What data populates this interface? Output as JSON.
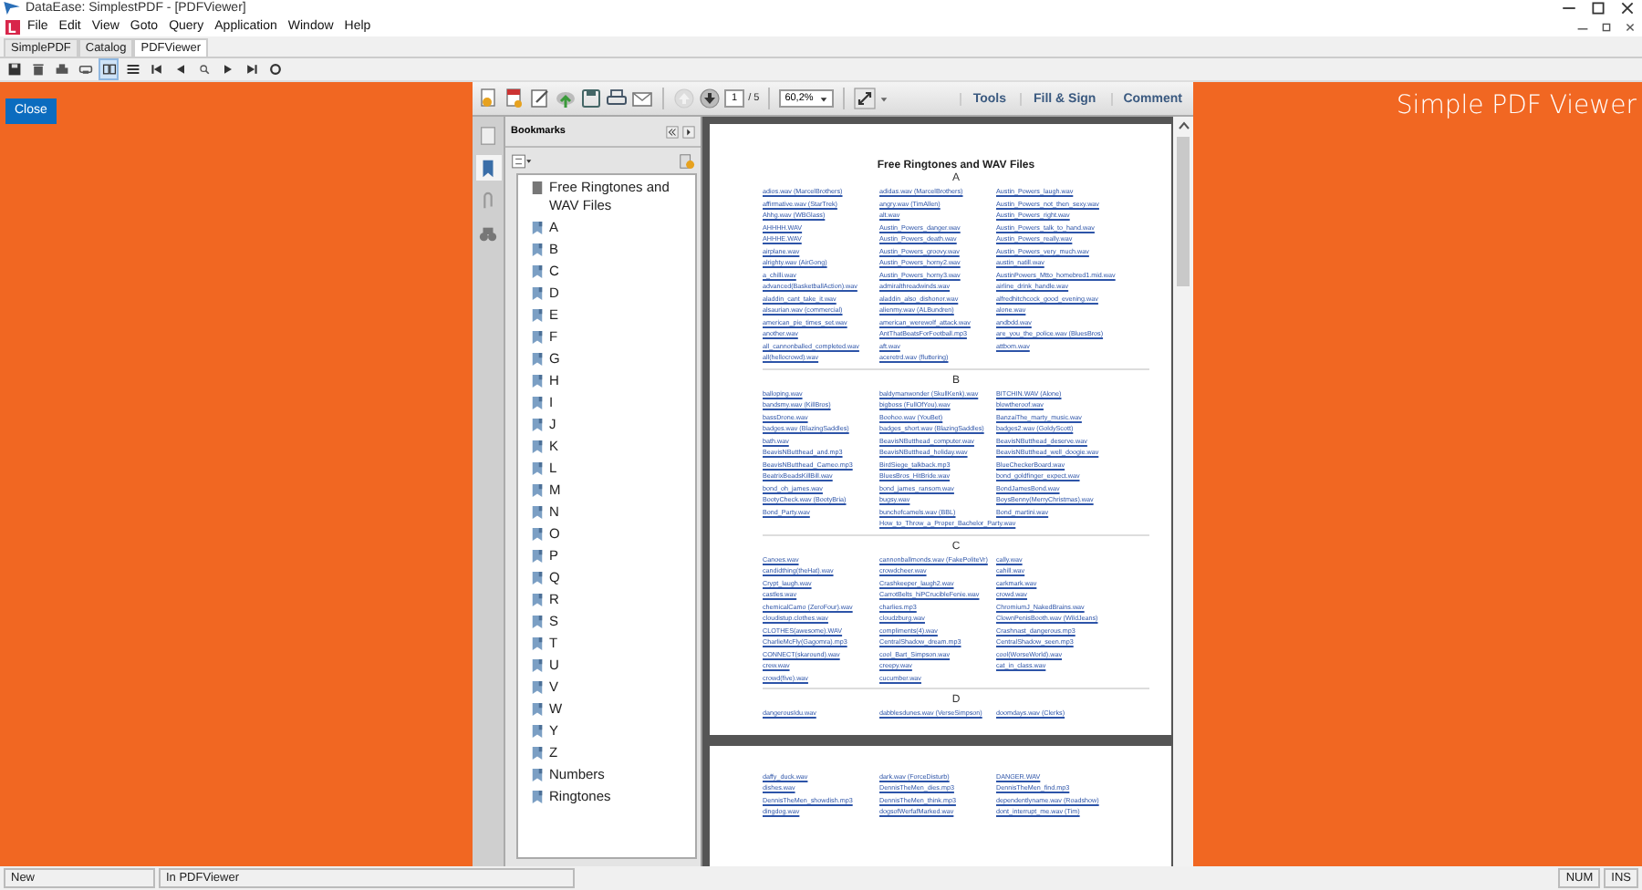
{
  "app": {
    "title": "DataEase: SimplestPDF - [PDFViewer]",
    "menu": [
      "File",
      "Edit",
      "View",
      "Goto",
      "Query",
      "Application",
      "Window",
      "Help"
    ],
    "tabs": [
      {
        "label": "SimplePDF",
        "selected": false
      },
      {
        "label": "Catalog",
        "selected": false
      },
      {
        "label": "PDFViewer",
        "selected": true
      }
    ],
    "toolbar": [
      {
        "kind": "save",
        "selected": false
      },
      {
        "kind": "trash",
        "selected": false
      },
      {
        "kind": "print",
        "selected": false
      },
      {
        "kind": "printer",
        "selected": false
      },
      {
        "kind": "pages",
        "selected": true
      },
      {
        "kind": "list",
        "selected": false
      },
      {
        "kind": "first",
        "selected": false
      },
      {
        "kind": "prev",
        "selected": false
      },
      {
        "kind": "search",
        "selected": false
      },
      {
        "kind": "next",
        "selected": false
      },
      {
        "kind": "last",
        "selected": false
      },
      {
        "kind": "refresh",
        "selected": false
      }
    ],
    "close_button": "Close",
    "viewer_title": "Simple PDF Viewer"
  },
  "pdf": {
    "tools": [
      {
        "kind": "convert"
      },
      {
        "kind": "attach"
      },
      {
        "kind": "edit"
      },
      {
        "kind": "upload"
      },
      {
        "kind": "save"
      },
      {
        "kind": "print"
      },
      {
        "kind": "mail"
      }
    ],
    "nav": [
      {
        "kind": "up",
        "disabled": true
      },
      {
        "kind": "down",
        "disabled": false
      }
    ],
    "page": "1",
    "page_count": "/ 5",
    "zoom": "60,2%",
    "tool_tabs": [
      "Tools",
      "Fill & Sign",
      "Comment"
    ],
    "side_icons": [
      {
        "kind": "page",
        "selected": false
      },
      {
        "kind": "bookmark",
        "selected": true
      },
      {
        "kind": "clip",
        "selected": false
      },
      {
        "kind": "binoculars",
        "selected": false
      }
    ],
    "panel_title": "Bookmarks",
    "bookmarks": [
      {
        "label": "Free Ringtones and WAV Files",
        "kind": "page"
      },
      {
        "label": "A",
        "kind": "mark"
      },
      {
        "label": "B",
        "kind": "mark"
      },
      {
        "label": "C",
        "kind": "mark"
      },
      {
        "label": "D",
        "kind": "mark"
      },
      {
        "label": "E",
        "kind": "mark"
      },
      {
        "label": "F",
        "kind": "mark"
      },
      {
        "label": "G",
        "kind": "mark"
      },
      {
        "label": "H",
        "kind": "mark"
      },
      {
        "label": "I",
        "kind": "mark"
      },
      {
        "label": "J",
        "kind": "mark"
      },
      {
        "label": "K",
        "kind": "mark"
      },
      {
        "label": "L",
        "kind": "mark"
      },
      {
        "label": "M",
        "kind": "mark"
      },
      {
        "label": "N",
        "kind": "mark"
      },
      {
        "label": "O",
        "kind": "mark"
      },
      {
        "label": "P",
        "kind": "mark"
      },
      {
        "label": "Q",
        "kind": "mark"
      },
      {
        "label": "R",
        "kind": "mark"
      },
      {
        "label": "S",
        "kind": "mark"
      },
      {
        "label": "T",
        "kind": "mark"
      },
      {
        "label": "U",
        "kind": "mark"
      },
      {
        "label": "V",
        "kind": "mark"
      },
      {
        "label": "W",
        "kind": "mark"
      },
      {
        "label": "Y",
        "kind": "mark"
      },
      {
        "label": "Z",
        "kind": "mark"
      },
      {
        "label": "Numbers",
        "kind": "mark"
      },
      {
        "label": "Ringtones",
        "kind": "mark"
      }
    ],
    "document": {
      "title": "Free Ringtones and WAV Files",
      "sections": [
        {
          "heading": "A",
          "columns": [
            [
              "adios.wav (MarcelBrothers)",
              "affirmative.wav (StarTrek)",
              "Ahhg.wav (WBGlass)",
              "AHHHH.WAV",
              "AHHHE.WAV",
              "airplane.wav",
              "alrighty.wav (AirGong)",
              "a_chilli.wav",
              "advanced(BasketballAction).wav",
              "aladdin_cant_take_it.wav",
              "alsaurian.wav (commercial)",
              "american_pie_times_set.wav",
              "another.wav",
              "all_cannonballed_completed.wav",
              "all(hellocrowd).wav"
            ],
            [
              "adidas.wav (MarcelBrothers)",
              "angry.wav (TimAllen)",
              "alt.wav",
              "Austin_Powers_danger.wav",
              "Austin_Powers_death.wav",
              "Austin_Powers_groovy.wav",
              "Austin_Powers_horny2.wav",
              "Austin_Powers_horny3.wav",
              "admiralthreadwinds.wav",
              "aladdin_also_dishonor.wav",
              "alienmy.wav (ALBundren)",
              "american_werewolf_attack.wav",
              "AntThatBeatsForFootball.mp3",
              "aft.wav",
              "aceretrd.wav (fluttering)"
            ],
            [
              "Austin_Powers_laugh.wav",
              "Austin_Powers_not_then_sexy.wav",
              "Austin_Powers_right.wav",
              "Austin_Powers_talk_to_hand.wav",
              "Austin_Powers_really.wav",
              "Austin_Powers_very_much.wav",
              "austin_natill.wav",
              "AustinPowers_Mtto_homebred1.mid.wav",
              "airline_drink_handle.wav",
              "alfredhitchcock_good_evening.wav",
              "alone.wav",
              "andbdd.wav",
              "are_you_the_police.wav (BluesBros)",
              "attbom.wav"
            ]
          ]
        },
        {
          "heading": "B",
          "columns": [
            [
              "balloping.wav",
              "bandsmy.wav (KillBros)",
              "bassDrone.wav",
              "badges.wav (BlazingSaddles)",
              "bath.wav",
              "BeavisNButthead_and.mp3",
              "BeavisNButthead_Cameo.mp3",
              "BeatrixBeadsKillBill.wav",
              "bond_oh_james.wav",
              "BootyCheck.wav (BootyBria)",
              "Bond_Party.wav"
            ],
            [
              "baldymanwonder (SkullKenk).wav",
              "bigboss (FullOfYou).wav",
              "Boohoo.wav (YouBet)",
              "badges_short.wav (BlazingSaddles)",
              "BeavisNButthead_computer.wav",
              "BeavisNButthead_holiday.wav",
              "BirdSiege_talkback.mp3",
              "BluesBros_HitBride.wav",
              "bond_james_ransom.wav",
              "bugsy.wav",
              "bunchofcamels.wav (BBL)",
              "How_to_Throw_a_Proper_Bachelor_Party.wav"
            ],
            [
              "BITCHIN.WAV (Alone)",
              "blowtheroof.wav",
              "BanzaiThe_marty_music.wav",
              "badges2.wav (GoldyScott)",
              "BeavisNButthead_deserve.wav",
              "BeavisNButthead_well_doogie.wav",
              "BlueCheckerBoard.wav",
              "bond_goldfinger_expect.wav",
              "BondJamesBond.wav",
              "BoysBenny(MerryChristmas).wav",
              "Bond_martini.wav"
            ]
          ]
        },
        {
          "heading": "C",
          "columns": [
            [
              "Canoes.wav",
              "candidthing(theHat).wav",
              "Crypt_laugh.wav",
              "castles.wav",
              "chemicalCamo (ZeroFour).wav",
              "cloudistup.clothes.wav",
              "CLOTHES(awesome).WAV",
              "CharlieMcFly(Gagomra).mp3",
              "CONNECT(skaround).wav",
              "crew.wav",
              "crowd(five).wav"
            ],
            [
              "cannonballmonds.wav (FakePoliteVr)",
              "crowdcheer.wav",
              "Crashkeeper_laugh2.wav",
              "CarrotBelts_hiPCrucibleFenie.wav",
              "charlies.mp3",
              "cloudzburg.wav",
              "compliments(4).wav",
              "CentralShadow_dream.mp3",
              "cool_Bart_Simpson.wav",
              "creepy.wav",
              "cucumber.wav"
            ],
            [
              "cally.wav",
              "cahill.wav",
              "carkmark.wav",
              "crowd.wav",
              "ChromiumJ_NakedBrains.wav",
              "ClownPenisBooth.wav (WildJeans)",
              "Crashnast_dangerous.mp3",
              "CentralShadow_seen.mp3",
              "cool(WorseWorld).wav",
              "cat_in_class.wav"
            ]
          ]
        },
        {
          "heading": "D",
          "columns": [
            [
              "dangerousIdu.wav"
            ],
            [
              "dabblesdunes.wav (VerseSimpson)"
            ],
            [
              "doomdays.wav (Clerks)"
            ]
          ]
        }
      ]
    },
    "next_page": {
      "columns": [
        [
          "daffy_duck.wav",
          "dishes.wav",
          "DennisTheMen_showdish.mp3",
          "dingdog.wav"
        ],
        [
          "dark.wav (ForceDisturb)",
          "DennisTheMen_dies.mp3",
          "DennisTheMen_think.mp3",
          "dogsofWerfafMarked.wav"
        ],
        [
          "DANGER.WAV",
          "DennisTheMen_find.mp3",
          "dependentlyname.wav (Roadshow)",
          "dont_interrupt_me.wav (Tim)"
        ]
      ]
    }
  },
  "status": {
    "mode": "New",
    "location": "In PDFViewer",
    "keys": [
      "NUM",
      "INS"
    ]
  }
}
